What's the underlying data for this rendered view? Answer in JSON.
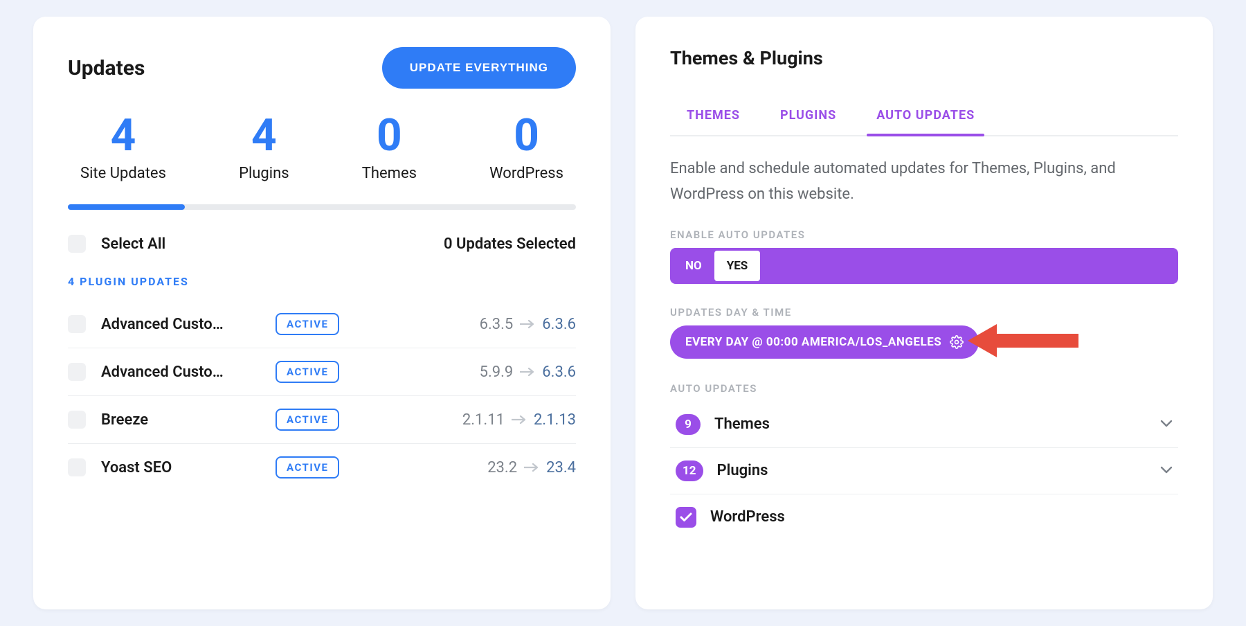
{
  "updates": {
    "title": "Updates",
    "update_all_btn": "UPDATE EVERYTHING",
    "stats": [
      {
        "value": "4",
        "label": "Site Updates"
      },
      {
        "value": "4",
        "label": "Plugins"
      },
      {
        "value": "0",
        "label": "Themes"
      },
      {
        "value": "0",
        "label": "WordPress"
      }
    ],
    "select_all": "Select All",
    "selected_text": "0 Updates Selected",
    "section_heading": "4 PLUGIN UPDATES",
    "plugins": [
      {
        "name": "Advanced Custo…",
        "status": "ACTIVE",
        "from": "6.3.5",
        "to": "6.3.6"
      },
      {
        "name": "Advanced Custo…",
        "status": "ACTIVE",
        "from": "5.9.9",
        "to": "6.3.6"
      },
      {
        "name": "Breeze",
        "status": "ACTIVE",
        "from": "2.1.11",
        "to": "2.1.13"
      },
      {
        "name": "Yoast SEO",
        "status": "ACTIVE",
        "from": "23.2",
        "to": "23.4"
      }
    ]
  },
  "themes_plugins": {
    "title": "Themes & Plugins",
    "tabs": {
      "themes": "THEMES",
      "plugins": "PLUGINS",
      "auto": "AUTO UPDATES"
    },
    "description": "Enable and schedule automated updates for Themes, Plugins, and WordPress on this website.",
    "enable_label": "ENABLE AUTO UPDATES",
    "toggle": {
      "no": "NO",
      "yes": "YES",
      "value": "YES"
    },
    "schedule_label": "UPDATES DAY & TIME",
    "schedule_text": "EVERY DAY  @ 00:00  AMERICA/LOS_ANGELES",
    "auto_label": "AUTO UPDATES",
    "items": {
      "themes": {
        "count": "9",
        "label": "Themes"
      },
      "plugins": {
        "count": "12",
        "label": "Plugins"
      },
      "wordpress": {
        "label": "WordPress"
      }
    }
  }
}
